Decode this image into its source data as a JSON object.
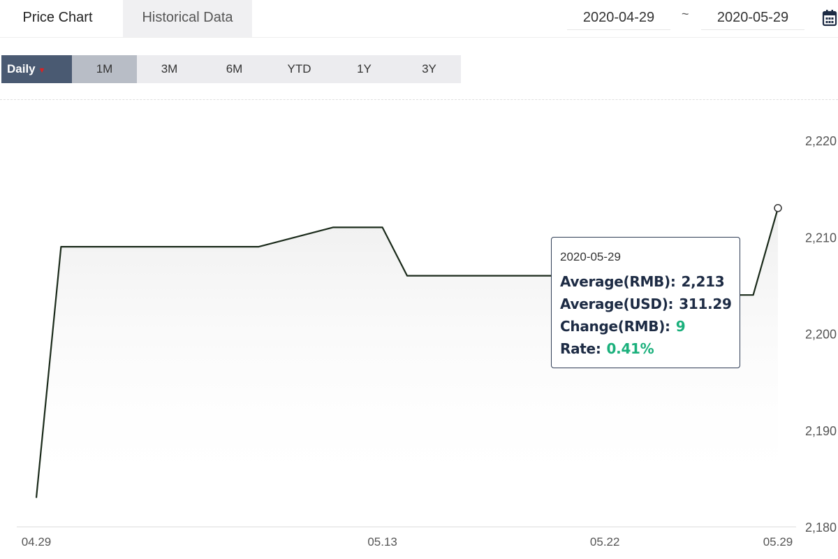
{
  "tabs": {
    "price_chart": "Price Chart",
    "historical_data": "Historical Data"
  },
  "date_range": {
    "start": "2020-04-29",
    "separator": "~",
    "end": "2020-05-29",
    "icon": "calendar-icon"
  },
  "periods": {
    "daily": "Daily",
    "items": [
      "1M",
      "3M",
      "6M",
      "YTD",
      "1Y",
      "3Y"
    ],
    "selected": "1M"
  },
  "tooltip": {
    "date": "2020-05-29",
    "avg_rmb_label": "Average(RMB):",
    "avg_rmb_value": "2,213",
    "avg_usd_label": "Average(USD):",
    "avg_usd_value": "311.29",
    "change_label": "Change(RMB):",
    "change_value": "9",
    "rate_label": "Rate:",
    "rate_value": "0.41%"
  },
  "colors": {
    "line": "#1a2a1a",
    "positive": "#1bb07c",
    "daily_bg": "#4a5a72",
    "selected_bg": "#b8bdc6",
    "tooltip_border": "#2f3d55"
  },
  "chart_data": {
    "type": "line",
    "title": "",
    "xlabel": "",
    "ylabel": "",
    "ylim": [
      2180,
      2220
    ],
    "y_ticks": [
      "2,180",
      "2,190",
      "2,200",
      "2,210",
      "2,220"
    ],
    "y_tick_values": [
      2180,
      2190,
      2200,
      2210,
      2220
    ],
    "x_ticks": [
      "04.29",
      "05.13",
      "05.22",
      "05.29"
    ],
    "x_tick_dates": [
      "2020-04-29",
      "2020-05-13",
      "2020-05-22",
      "2020-05-29"
    ],
    "grid": false,
    "series": [
      {
        "x": [
          "2020-04-29",
          "2020-04-30",
          "2020-05-06",
          "2020-05-07",
          "2020-05-08",
          "2020-05-11",
          "2020-05-12",
          "2020-05-13",
          "2020-05-14",
          "2020-05-15",
          "2020-05-18",
          "2020-05-19",
          "2020-05-20",
          "2020-05-21",
          "2020-05-22",
          "2020-05-25",
          "2020-05-26",
          "2020-05-27",
          "2020-05-28",
          "2020-05-29"
        ],
        "values": [
          2183,
          2209,
          2209,
          2209,
          2209,
          2211,
          2211,
          2211,
          2206,
          2206,
          2206,
          2206,
          2206,
          2206,
          2206,
          2206,
          2206,
          2204,
          2204,
          2213
        ]
      }
    ]
  }
}
